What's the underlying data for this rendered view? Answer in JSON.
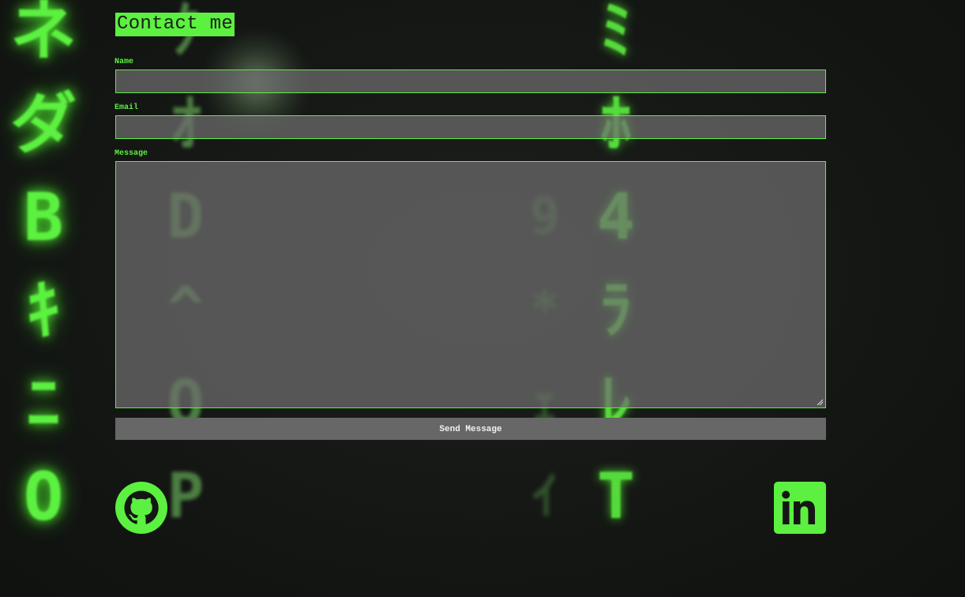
{
  "contact": {
    "title": "Contact me",
    "name_label": "Name",
    "name_value": "",
    "email_label": "Email",
    "email_value": "",
    "message_label": "Message",
    "message_value": "",
    "send_label": "Send Message"
  },
  "social": {
    "github_icon": "github-icon",
    "linkedin_icon": "linkedin-icon"
  },
  "colors": {
    "accent": "#5cf040",
    "background": "#141614",
    "field_bg": "#6e6e6e",
    "button_bg": "#666766"
  },
  "background_rain": {
    "col_a": [
      "ネ",
      "ダ",
      "B",
      "ｷ",
      "ﾆ",
      "O"
    ],
    "col_b": [
      "ｸ",
      "ｵ",
      "D",
      "^",
      "Q",
      "P"
    ],
    "col_c": [
      "",
      "",
      "9",
      "*",
      "ｪ",
      "ｲ"
    ],
    "col_d": [
      "ﾐ",
      "ﾎ",
      "4",
      "ﾗ",
      "ﾚ",
      "T"
    ]
  }
}
